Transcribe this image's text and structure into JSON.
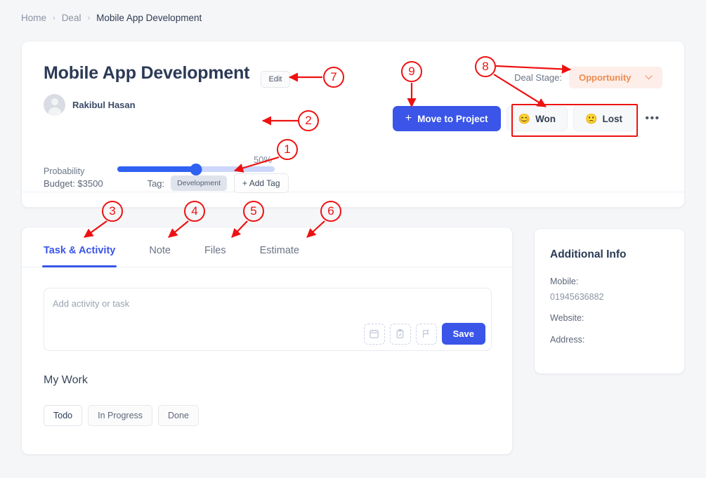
{
  "breadcrumb": {
    "home": "Home",
    "deal": "Deal",
    "current": "Mobile App Development",
    "separator": "›"
  },
  "deal": {
    "title": "Mobile App Development",
    "edit_label": "Edit",
    "owner_name": "Rakibul Hasan",
    "probability_label": "Probability",
    "probability_value": "50%",
    "probability_percent": 50,
    "budget_label": "Budget: $3500",
    "tag_label": "Tag:",
    "tag_chip": "Development",
    "add_tag_label": "+ Add Tag"
  },
  "stage": {
    "label": "Deal Stage:",
    "value": "Opportunity",
    "chevron": "∨",
    "text_color": "#ef8b4e",
    "bg_color": "#fdeeea"
  },
  "actions": {
    "move_plus": "+",
    "move_label": "Move to Project",
    "won_emoji": "😊",
    "won_label": "Won",
    "lost_emoji": "🙁",
    "lost_label": "Lost",
    "more_label": "•••",
    "primary_color": "#3a55e8"
  },
  "tabs": [
    {
      "label": "Task & Activity",
      "active": true
    },
    {
      "label": "Note",
      "active": false
    },
    {
      "label": "Files",
      "active": false
    },
    {
      "label": "Estimate",
      "active": false
    }
  ],
  "activity": {
    "placeholder": "Add activity or task",
    "value": "",
    "save_label": "Save",
    "icons": [
      "calendar-icon",
      "clipboard-check-icon",
      "flag-icon"
    ]
  },
  "mywork": {
    "title": "My Work",
    "chips": [
      {
        "label": "Todo",
        "selected": true
      },
      {
        "label": "In Progress",
        "selected": false
      },
      {
        "label": "Done",
        "selected": false
      }
    ]
  },
  "aside": {
    "title": "Additional Info",
    "mobile_label": "Mobile:",
    "mobile_value": "01945636882",
    "website_label": "Website:",
    "website_value": "",
    "address_label": "Address:",
    "address_value": ""
  },
  "annotations": {
    "color": "#ee1111",
    "markers": [
      {
        "id": "1",
        "label": "1"
      },
      {
        "id": "2",
        "label": "2"
      },
      {
        "id": "3",
        "label": "3"
      },
      {
        "id": "4",
        "label": "4"
      },
      {
        "id": "5",
        "label": "5"
      },
      {
        "id": "6",
        "label": "6"
      },
      {
        "id": "7",
        "label": "7"
      },
      {
        "id": "8",
        "label": "8"
      },
      {
        "id": "9",
        "label": "9"
      }
    ]
  }
}
